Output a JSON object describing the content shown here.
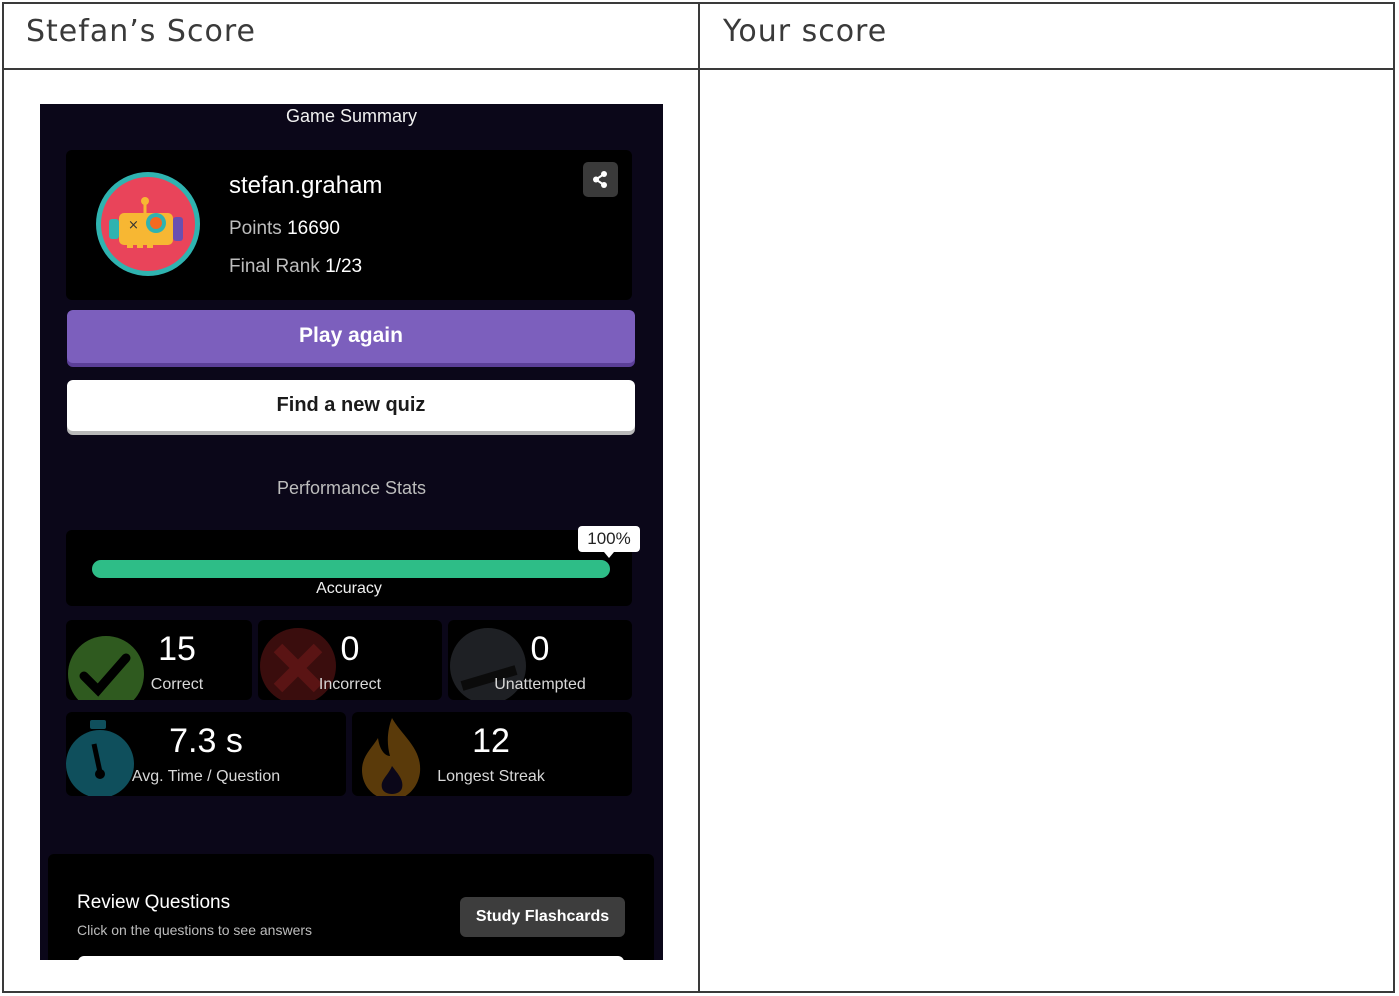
{
  "columns": {
    "left_header": "Stefan’s Score",
    "right_header": "Your score"
  },
  "game_summary": {
    "title": "Game Summary",
    "username": "stefan.graham",
    "points_label": "Points",
    "points_value": "16690",
    "rank_label": "Final Rank",
    "rank_value": "1/23",
    "share_icon": "share-icon",
    "play_again_label": "Play again",
    "find_quiz_label": "Find a new quiz",
    "performance_title": "Performance Stats",
    "accuracy": {
      "label": "Accuracy",
      "value_text": "100%",
      "value": 1.0
    },
    "stats": {
      "correct": {
        "value": "15",
        "label": "Correct"
      },
      "incorrect": {
        "value": "0",
        "label": "Incorrect"
      },
      "unattempted": {
        "value": "0",
        "label": "Unattempted"
      },
      "avg_time": {
        "value": "7.3 s",
        "label": "Avg. Time / Question"
      },
      "streak": {
        "value": "12",
        "label": "Longest Streak"
      }
    },
    "review": {
      "title": "Review Questions",
      "subtitle": "Click on the questions to see answers",
      "flashcards_label": "Study Flashcards"
    }
  },
  "colors": {
    "primary": "#7c5fbd",
    "accuracy_bar": "#2ebd87",
    "screen_bg": "#0b0719",
    "correct_icon": "#2f5a1f",
    "incorrect_icon": "#5a1414",
    "time_icon": "#0f4f5c",
    "streak_icon": "#5a3a0a"
  }
}
